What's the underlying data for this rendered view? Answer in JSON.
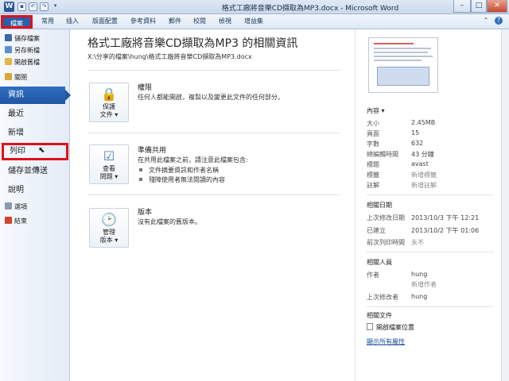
{
  "window": {
    "title": "格式工廠將音樂CD擷取為MP3.docx - Microsoft Word",
    "app_icon": "W",
    "controls": {
      "minimize": "–",
      "maximize": "□",
      "close": "✕"
    }
  },
  "ribbon": {
    "tabs": [
      "檔案",
      "常用",
      "插入",
      "版面配置",
      "參考資料",
      "郵件",
      "校閱",
      "檢視",
      "增益集"
    ]
  },
  "leftnav": {
    "commands_top": [
      "儲存檔案",
      "另存新檔",
      "開啟舊檔",
      "關閉"
    ],
    "items": [
      "資訊",
      "最近",
      "新增",
      "列印",
      "儲存並傳送",
      "說明"
    ],
    "commands_bottom": [
      "選項",
      "結束"
    ]
  },
  "info": {
    "title": "格式工廠將音樂CD擷取為MP3 的相關資訊",
    "path": "X:\\分享的檔案\\hung\\格式工廠將音樂CD擷取為MP3.docx",
    "permissions": {
      "button": [
        "保護",
        "文件 ▾"
      ],
      "title": "權限",
      "desc": "任何人都能開啟，複製以及變更此文件的任何部分。"
    },
    "prepare": {
      "button": [
        "查看",
        "問題 ▾"
      ],
      "title": "準備共用",
      "desc": "在共用此檔案之前，請注意此檔案包含:",
      "bullets": [
        "文件摘要資訊和作者名稱",
        "殘障使用者無法閱讀的內容"
      ]
    },
    "versions": {
      "button": [
        "管理",
        "版本 ▾"
      ],
      "title": "版本",
      "desc": "沒有此檔案的舊版本。"
    }
  },
  "properties": {
    "header": "內容 ▾",
    "rows": [
      {
        "k": "大小",
        "v": "2.45MB"
      },
      {
        "k": "頁面",
        "v": "15"
      },
      {
        "k": "字數",
        "v": "632"
      },
      {
        "k": "總編輯時間",
        "v": "43 分鐘"
      },
      {
        "k": "標題",
        "v": "avast"
      },
      {
        "k": "標籤",
        "v": "新增標籤"
      },
      {
        "k": "註解",
        "v": "新增註解"
      }
    ],
    "dates_header": "相關日期",
    "dates": [
      {
        "k": "上次修改日期",
        "v": "2013/10/3 下午 12:21"
      },
      {
        "k": "已建立",
        "v": "2013/10/2 下午 01:06"
      },
      {
        "k": "前次列印時間",
        "v": "永不"
      }
    ],
    "people_header": "相關人員",
    "author_label": "作者",
    "author": "hung",
    "add_author": "新增作者",
    "modified_by_label": "上次修改者",
    "modified_by": "hung",
    "docs_header": "相關文件",
    "open_location": "開啟檔案位置",
    "show_all": "顯示所有屬性"
  }
}
